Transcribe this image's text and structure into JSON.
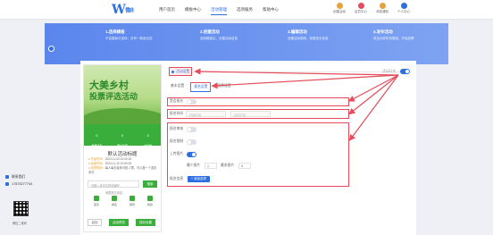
{
  "nav": {
    "logo": "W",
    "logo_sub": "微8",
    "items": [
      "用户首页",
      "模板中心",
      "活动管理",
      "选项服务",
      "帮助中心"
    ],
    "active_index": 2
  },
  "top_icons": [
    {
      "label": "创建活动",
      "color": "#e6a23c"
    },
    {
      "label": "会员中心",
      "color": "#e54b5a"
    },
    {
      "label": "消息通知",
      "color": "#e6a23c"
    },
    {
      "label": "个人中心",
      "color": "#2d6fe0"
    }
  ],
  "steps": [
    {
      "title": "1.选择模板",
      "desc": "丰富模板可选择，总有一款适合您"
    },
    {
      "title": "2.创建活动",
      "desc": "选择模板后，设置活动信息"
    },
    {
      "title": "3.编辑活动",
      "desc": "设置活动规则，参赛选手信息"
    },
    {
      "title": "4.发布活动",
      "desc": "将活动发布到微信，开始投票"
    }
  ],
  "preview": {
    "title1": "大美乡村",
    "title2": "投票评选活动",
    "stats": [
      {
        "num": "0",
        "label": "参赛选手"
      },
      {
        "num": "0",
        "label": "累计投票"
      },
      {
        "num": "0",
        "label": "访问量"
      }
    ],
    "activity_name": "默认活动标题",
    "info": [
      {
        "k": "● 开始时间：",
        "v": "2023-11-03 10:00:15"
      },
      {
        "k": "● 结束时间：",
        "v": "2023-11-10 10:00:15"
      },
      {
        "k": "● 投票规则：",
        "v": "每人每天最多可投 3 票，可以投一个选手多次"
      }
    ],
    "search_placeholder": "请输入选手名称或编号",
    "search_btn": "搜索",
    "sign_text": "我要报名参赛",
    "tabs": [
      "首页",
      "排名",
      "规则",
      "我的"
    ],
    "back_btn": "返回",
    "prev_btn": "活动预览",
    "save_btn": "保存设置"
  },
  "config": {
    "active_setting": "活动设置",
    "top_toggle_label": "活动开关",
    "tabs": [
      "基本设置",
      "报名设置",
      "投票设置"
    ],
    "active_tab": 1,
    "row1_label": "是否报名",
    "row2_label": "报名时间",
    "start_placeholder": "开始时间",
    "end_placeholder": "结束时间",
    "row3_label": "报名审核",
    "row4_label": "报名限制",
    "row5_label": "上传图片",
    "min_label": "最少图片",
    "min_value": "1",
    "max_label": "最多图片",
    "max_value": "3",
    "row6_label": "报名信息",
    "add_btn": "+ 添加选项"
  },
  "contact": {
    "title": "联系我们",
    "phone": "17875277744",
    "qr_label": "微信二维码"
  }
}
